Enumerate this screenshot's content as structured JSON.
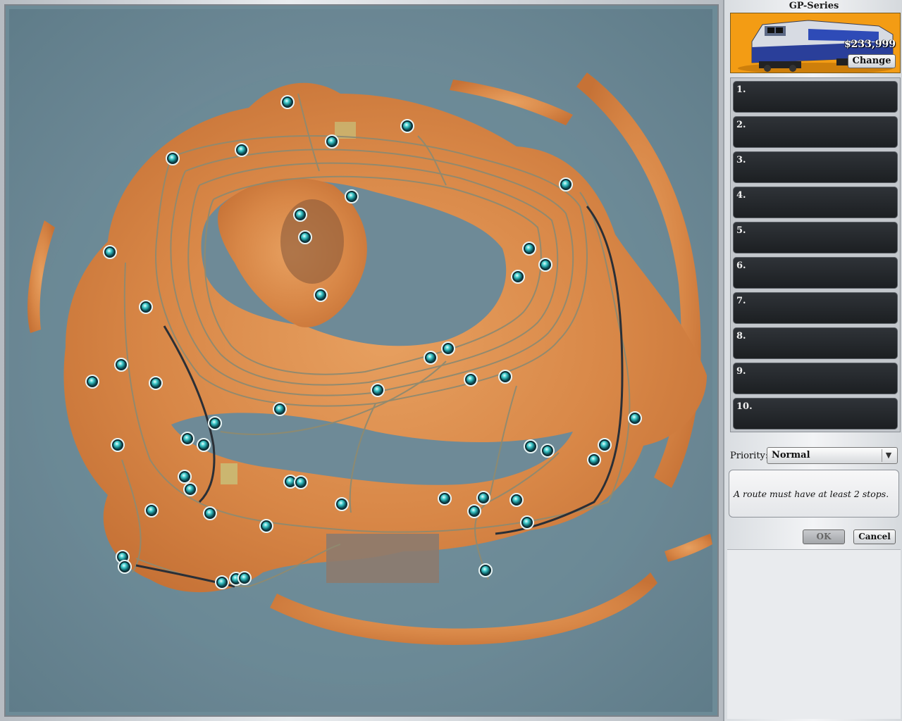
{
  "locomotive": {
    "name": "GP-Series",
    "price": "$233,999",
    "change_label": "Change"
  },
  "route": {
    "stops": [
      {
        "number": "1."
      },
      {
        "number": "2."
      },
      {
        "number": "3."
      },
      {
        "number": "4."
      },
      {
        "number": "5."
      },
      {
        "number": "6."
      },
      {
        "number": "7."
      },
      {
        "number": "8."
      },
      {
        "number": "9."
      },
      {
        "number": "10."
      }
    ],
    "priority_label": "Priority:",
    "priority_value": "Normal",
    "message": "A route must have at least 2 stops.",
    "ok_label": "OK",
    "cancel_label": "Cancel"
  },
  "colors": {
    "water": "#6f8b98",
    "land": "#d98a4e",
    "track": "#8f8a70",
    "station": "#34c3c4",
    "loco_card": "#f39c14"
  }
}
